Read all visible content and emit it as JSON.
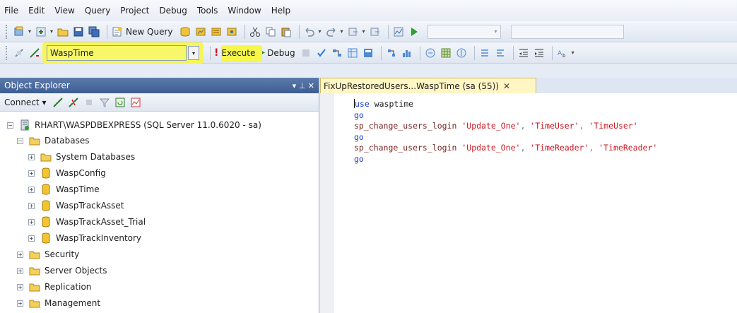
{
  "menu": [
    "File",
    "Edit",
    "View",
    "Query",
    "Project",
    "Debug",
    "Tools",
    "Window",
    "Help"
  ],
  "toolbar1": {
    "new_query_label": "New Query"
  },
  "toolbar2": {
    "database_selected": "WaspTime",
    "execute_label": "Execute",
    "debug_label": "Debug"
  },
  "object_explorer": {
    "title": "Object Explorer",
    "title_controls": "▾ ⊥ ✕",
    "connect_label": "Connect",
    "server": "RHART\\WASPDBEXPRESS (SQL Server 11.0.6020 - sa)",
    "databases_label": "Databases",
    "databases": [
      "System Databases",
      "WaspConfig",
      "WaspTime",
      "WaspTrackAsset",
      "WaspTrackAsset_Trial",
      "WaspTrackInventory"
    ],
    "folders": [
      "Security",
      "Server Objects",
      "Replication",
      "Management"
    ]
  },
  "editor": {
    "tab_title": "FixUpRestoredUsers...WaspTime (sa (55))",
    "lines": [
      {
        "kw": "use",
        "rest": " wasptime"
      },
      {
        "kw": "go"
      },
      {
        "fn": "sp_change_users_login",
        "args": [
          "'Update_One'",
          "'TimeUser'",
          "'TimeUser'"
        ]
      },
      {
        "kw": "go"
      },
      {
        "fn": "sp_change_users_login",
        "args": [
          "'Update_One'",
          "'TimeReader'",
          "'TimeReader'"
        ]
      },
      {
        "kw": "go"
      }
    ]
  },
  "colors": {
    "highlight": "#f6f64b",
    "oe_title": "#3d5d94",
    "tab_bg": "#fff6c4",
    "keyword": "#1c3bd6",
    "string": "#c8141e"
  }
}
